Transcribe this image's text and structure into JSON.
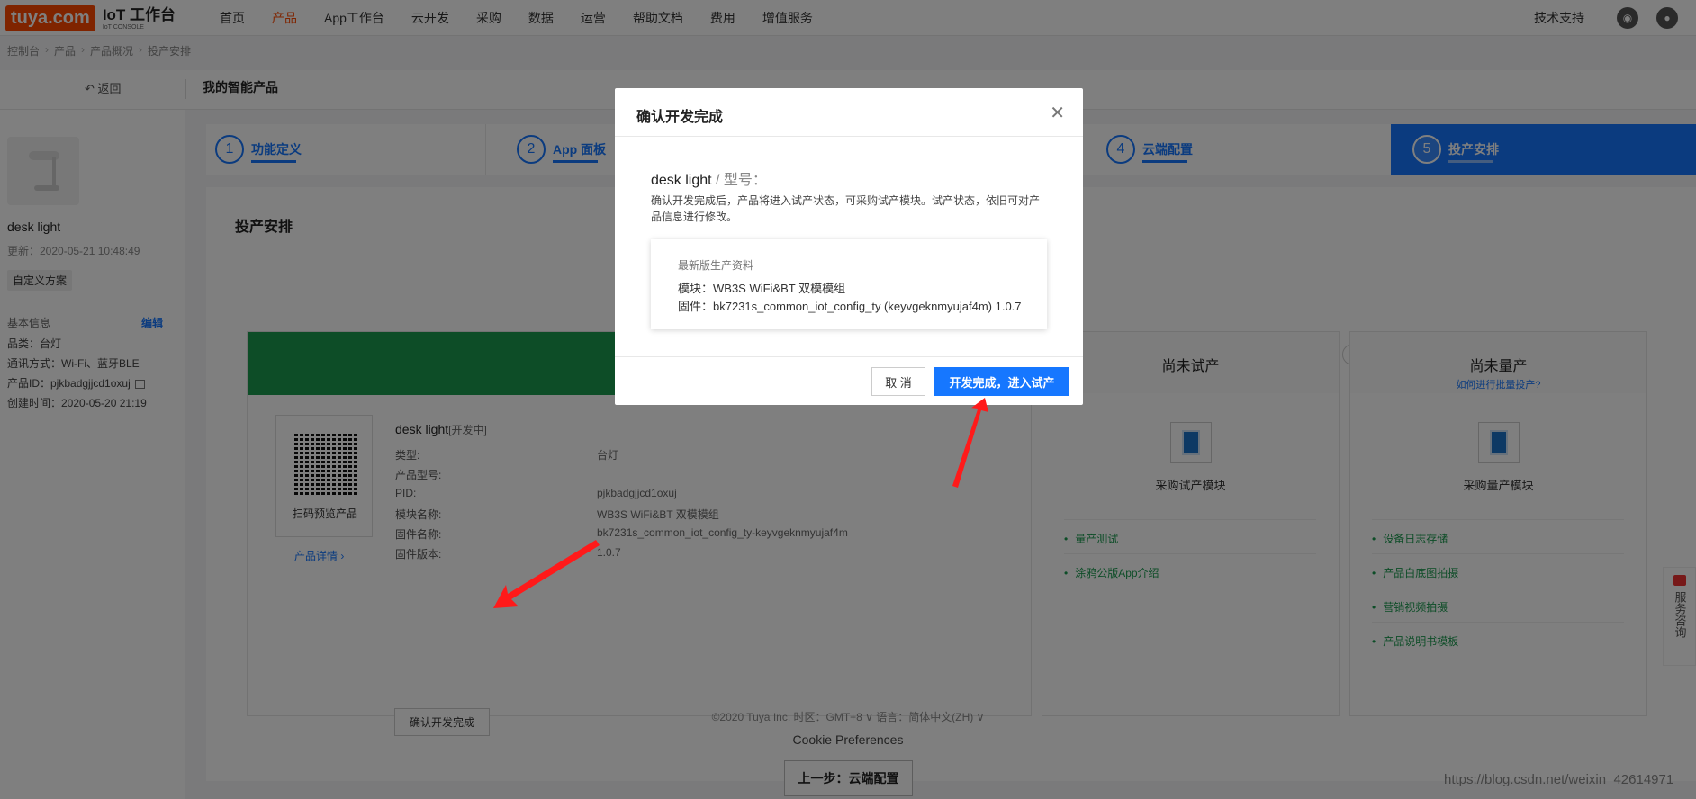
{
  "nav": {
    "logo_brand": "tuya.com",
    "logo_title": "IoT 工作台",
    "logo_sub": "IoT CONSOLE",
    "items": [
      "首页",
      "产品",
      "App工作台",
      "云开发",
      "采购",
      "数据",
      "运营",
      "帮助文档",
      "费用",
      "增值服务"
    ],
    "active_index": 1,
    "support": "技术支持"
  },
  "breadcrumb": [
    "控制台",
    "产品",
    "产品概况",
    "投产安排"
  ],
  "subheader": {
    "back": "返回",
    "title": "我的智能产品"
  },
  "sidebar": {
    "name": "desk light",
    "updated": "更新：2020-05-21 10:48:49",
    "tag": "自定义方案",
    "basic_info": "基本信息",
    "edit": "编辑",
    "rows": [
      "品类：台灯",
      "通讯方式：Wi-Fi、蓝牙BLE",
      "产品ID：pjkbadgjjcd1oxuj",
      "创建时间：2020-05-20 21:19"
    ]
  },
  "steps": [
    {
      "num": "1",
      "label": "功能定义"
    },
    {
      "num": "2",
      "label": "App 面板"
    },
    {
      "num": "4",
      "label": "云端配置"
    },
    {
      "num": "5",
      "label": "投产安排"
    }
  ],
  "panel": {
    "title": "投产安排",
    "card": {
      "qr_label": "扫码预览产品",
      "detail_link": "产品详情 ›",
      "name": "desk light",
      "status": "[开发中]",
      "keys": [
        "类型:",
        "产品型号:",
        "PID:",
        "模块名称:",
        "固件名称:",
        "固件版本:"
      ],
      "values": [
        "台灯",
        "",
        "pjkbadgjjcd1oxuj",
        "WB3S WiFi&BT 双模模组",
        "bk7231s_common_iot_config_ty-keyvgeknmyujaf4m",
        "1.0.7"
      ],
      "confirm": "确认开发完成"
    },
    "trial": {
      "title": "尚未试产",
      "module": "采购试产模块",
      "features": [
        "量产测试",
        "涂鸦公版App介绍"
      ]
    },
    "mass": {
      "title": "尚未量产",
      "subtitle": "如何进行批量投产?",
      "module": "采购量产模块",
      "features": [
        "设备日志存储",
        "产品白底图拍摄",
        "营销视频拍摄",
        "产品说明书模板"
      ]
    }
  },
  "footer": {
    "copyright": "©2020 Tuya Inc.   时区：GMT+8 ∨   语言：简体中文(ZH) ∨",
    "cookie": "Cookie Preferences",
    "prev": "上一步：云端配置",
    "watermark": "https://blog.csdn.net/weixin_42614971"
  },
  "service": "服务咨询",
  "modal": {
    "title": "确认开发完成",
    "name": "desk light",
    "model": " / 型号：",
    "desc": "确认开发完成后，产品将进入试产状态，可采购试产模块。试产状态，依旧可对产品信息进行修改。",
    "box_title": "最新版生产资料",
    "box_module": "模块：WB3S WiFi&BT 双模模组",
    "box_firmware": "固件：bk7231s_common_iot_config_ty (keyvgeknmyujaf4m) 1.0.7",
    "cancel": "取 消",
    "ok": "开发完成，进入试产"
  },
  "colors": {
    "brand": "#ff4800",
    "primary": "#1677ff",
    "green": "#1a9a4f",
    "arrow": "#ff1a1a"
  }
}
